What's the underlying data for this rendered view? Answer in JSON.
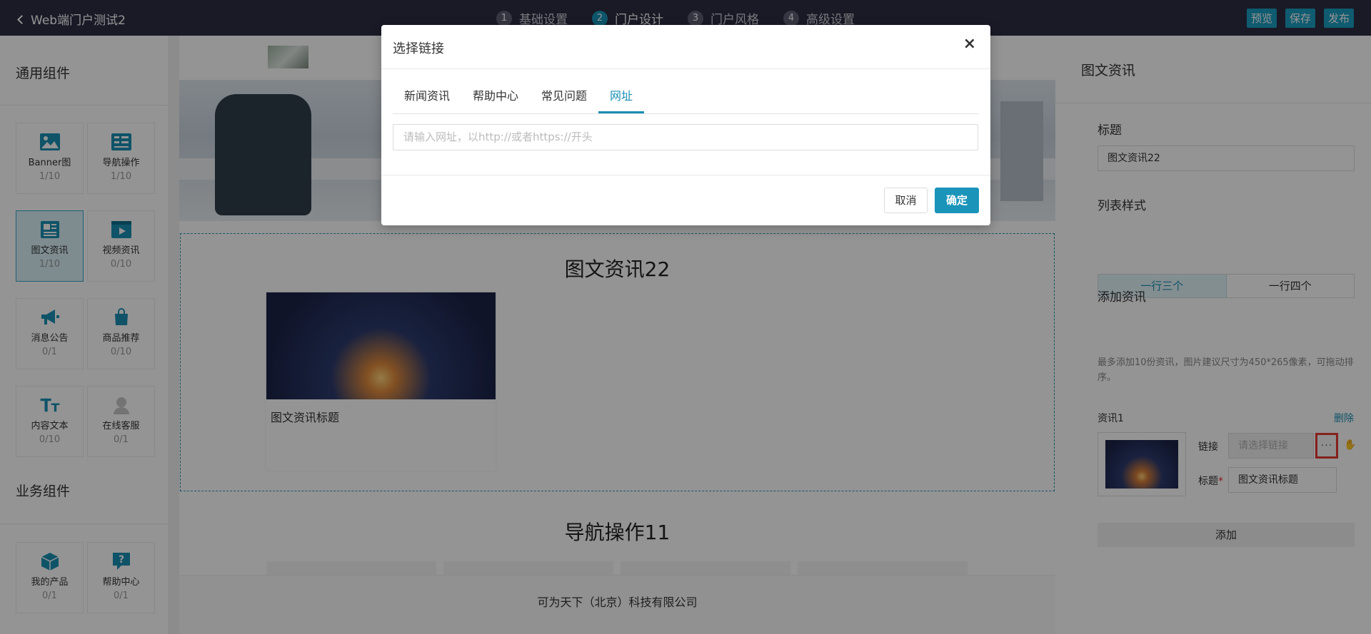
{
  "topbar": {
    "back_title": "Web端门户测试2",
    "steps": [
      {
        "num": "1",
        "label": "基础设置"
      },
      {
        "num": "2",
        "label": "门户设计"
      },
      {
        "num": "3",
        "label": "门户风格"
      },
      {
        "num": "4",
        "label": "高级设置"
      }
    ],
    "actions": {
      "preview": "预览",
      "save": "保存",
      "publish": "发布"
    }
  },
  "left": {
    "general_title": "通用组件",
    "general": [
      {
        "label": "Banner图",
        "count": "1/10",
        "icon": "image-icon"
      },
      {
        "label": "导航操作",
        "count": "1/10",
        "icon": "nav-grid-icon"
      },
      {
        "label": "图文资讯",
        "count": "1/10",
        "icon": "article-icon"
      },
      {
        "label": "视频资讯",
        "count": "0/10",
        "icon": "video-icon"
      },
      {
        "label": "消息公告",
        "count": "0/1",
        "icon": "megaphone-icon"
      },
      {
        "label": "商品推荐",
        "count": "0/10",
        "icon": "shopping-bag-icon"
      },
      {
        "label": "内容文本",
        "count": "0/10",
        "icon": "text-icon"
      },
      {
        "label": "在线客服",
        "count": "0/1",
        "icon": "support-agent-icon"
      }
    ],
    "business_title": "业务组件",
    "business": [
      {
        "label": "我的产品",
        "count": "0/1",
        "icon": "cube-icon"
      },
      {
        "label": "帮助中心",
        "count": "0/1",
        "icon": "help-icon"
      }
    ]
  },
  "canvas": {
    "news_title": "图文资讯22",
    "card_title": "图文资讯标题",
    "nav_title": "导航操作11",
    "footer": "可为天下（北京）科技有限公司"
  },
  "panel": {
    "title": "图文资讯",
    "title_label": "标题",
    "title_value": "图文资讯22",
    "style_label": "列表样式",
    "style_options": [
      "一行三个",
      "一行四个"
    ],
    "add_label": "添加资讯",
    "hint": "最多添加10份资讯，图片建议尺寸为450*265像素，可拖动排序。",
    "item_label": "资讯1",
    "delete": "删除",
    "link_label": "链接",
    "link_placeholder": "请选择链接",
    "more": "···",
    "item_title_label": "标题",
    "required_mark": "*",
    "item_title_value": "图文资讯标题",
    "add_button": "添加"
  },
  "modal": {
    "title": "选择链接",
    "close": "×",
    "tabs": [
      "新闻资讯",
      "帮助中心",
      "常见问题",
      "网址"
    ],
    "active_tab": "网址",
    "url_placeholder": "请输入网址，以http://或者https://开头",
    "cancel": "取消",
    "ok": "确定"
  },
  "colors": {
    "accent": "#1a94b8",
    "topbar": "#2b2d42",
    "highlight": "#e53935"
  }
}
